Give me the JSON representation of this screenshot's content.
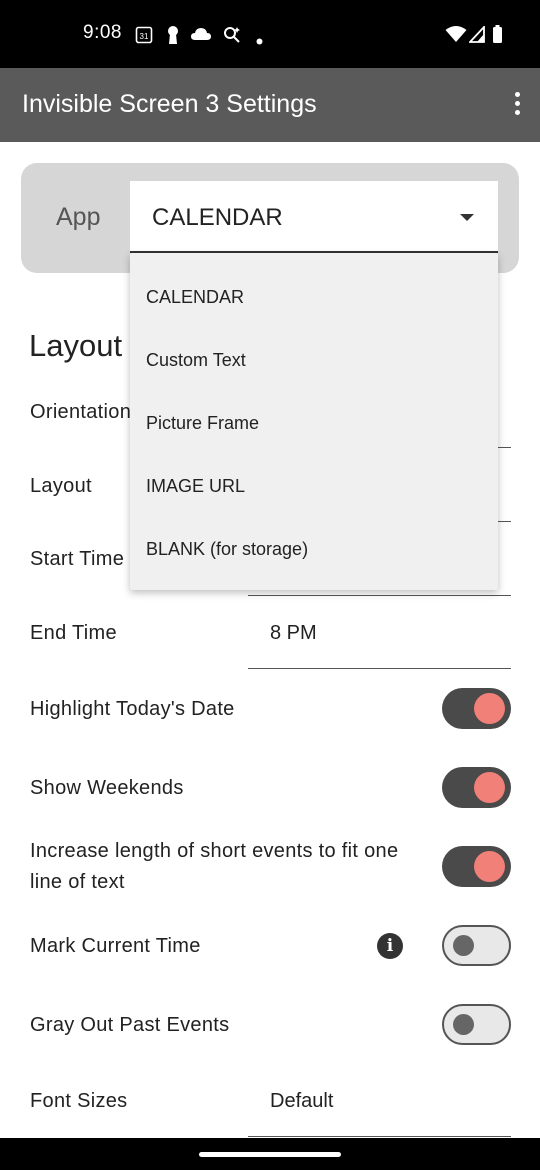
{
  "status_bar": {
    "time": "9:08",
    "icons": [
      "calendar-icon",
      "keyhole-icon",
      "cloud-icon",
      "search-sparkle-icon",
      "dot-icon",
      "wifi-icon",
      "signal-icon",
      "battery-icon"
    ],
    "calendar_badge": "31"
  },
  "app_bar": {
    "title": "Invisible Screen 3 Settings",
    "menu_icon": "more-vert-icon"
  },
  "app_selector": {
    "label": "App",
    "selected": "CALENDAR",
    "options": [
      "CALENDAR",
      "Custom Text",
      "Picture Frame",
      "IMAGE URL",
      "BLANK (for storage)"
    ]
  },
  "layout_section": {
    "title": "Layout",
    "orientation_label": "Orientation",
    "layout_label": "Layout",
    "start_time_label": "Start Time",
    "end_time_label": "End Time",
    "end_time_value": "8 PM"
  },
  "toggles": [
    {
      "label": "Highlight Today's Date",
      "on": true
    },
    {
      "label": "Show Weekends",
      "on": true
    },
    {
      "label": "Increase length of short events to fit one line of text",
      "on": true
    },
    {
      "label": "Mark Current Time",
      "on": false
    },
    {
      "label": "Gray Out Past Events",
      "on": false
    }
  ],
  "font_sizes": {
    "label": "Font Sizes",
    "value": "Default"
  },
  "colors": {
    "status_bar": "#000000",
    "app_bar": "#5a5a5a",
    "toggle_track_on": "#4a4a4a",
    "toggle_knob_on": "#f08078",
    "card_background": "#d6d6d6",
    "dropdown_background": "#f0f0f0"
  }
}
